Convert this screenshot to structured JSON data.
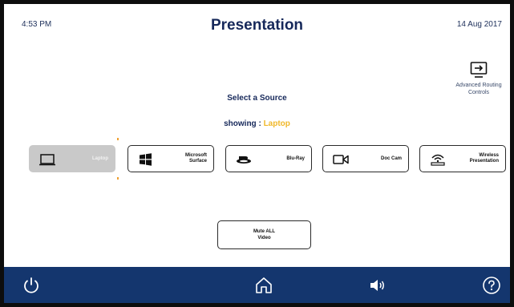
{
  "header": {
    "time": "4:53 PM",
    "title": "Presentation",
    "date": "14 Aug 2017"
  },
  "advanced": {
    "label_line1": "Advanced Routing",
    "label_line2": "Controls",
    "icon": "screen-routing-icon"
  },
  "source_panel": {
    "title": "Select a Source",
    "showing_prefix": "showing : ",
    "showing_value": "Laptop",
    "accent_color": "#f0b82a"
  },
  "sources": [
    {
      "id": "laptop",
      "line1": "Laptop",
      "line2": "",
      "icon": "laptop-icon",
      "selected": true
    },
    {
      "id": "surface",
      "line1": "Microsoft",
      "line2": "Surface",
      "icon": "windows-icon",
      "selected": false
    },
    {
      "id": "bluray",
      "line1": "Blu-Ray",
      "line2": "",
      "icon": "bluray-icon",
      "selected": false
    },
    {
      "id": "doccam",
      "line1": "Doc Cam",
      "line2": "",
      "icon": "video-camera-icon",
      "selected": false
    },
    {
      "id": "wireless",
      "line1": "Wireless",
      "line2": "Presentation",
      "icon": "wireless-presentation-icon",
      "selected": false
    }
  ],
  "mute": {
    "line1": "Mute ALL",
    "line2": "Video"
  },
  "footer": {
    "background": "#14366e",
    "icons": [
      "power-icon",
      "home-icon",
      "volume-icon",
      "help-icon"
    ]
  }
}
